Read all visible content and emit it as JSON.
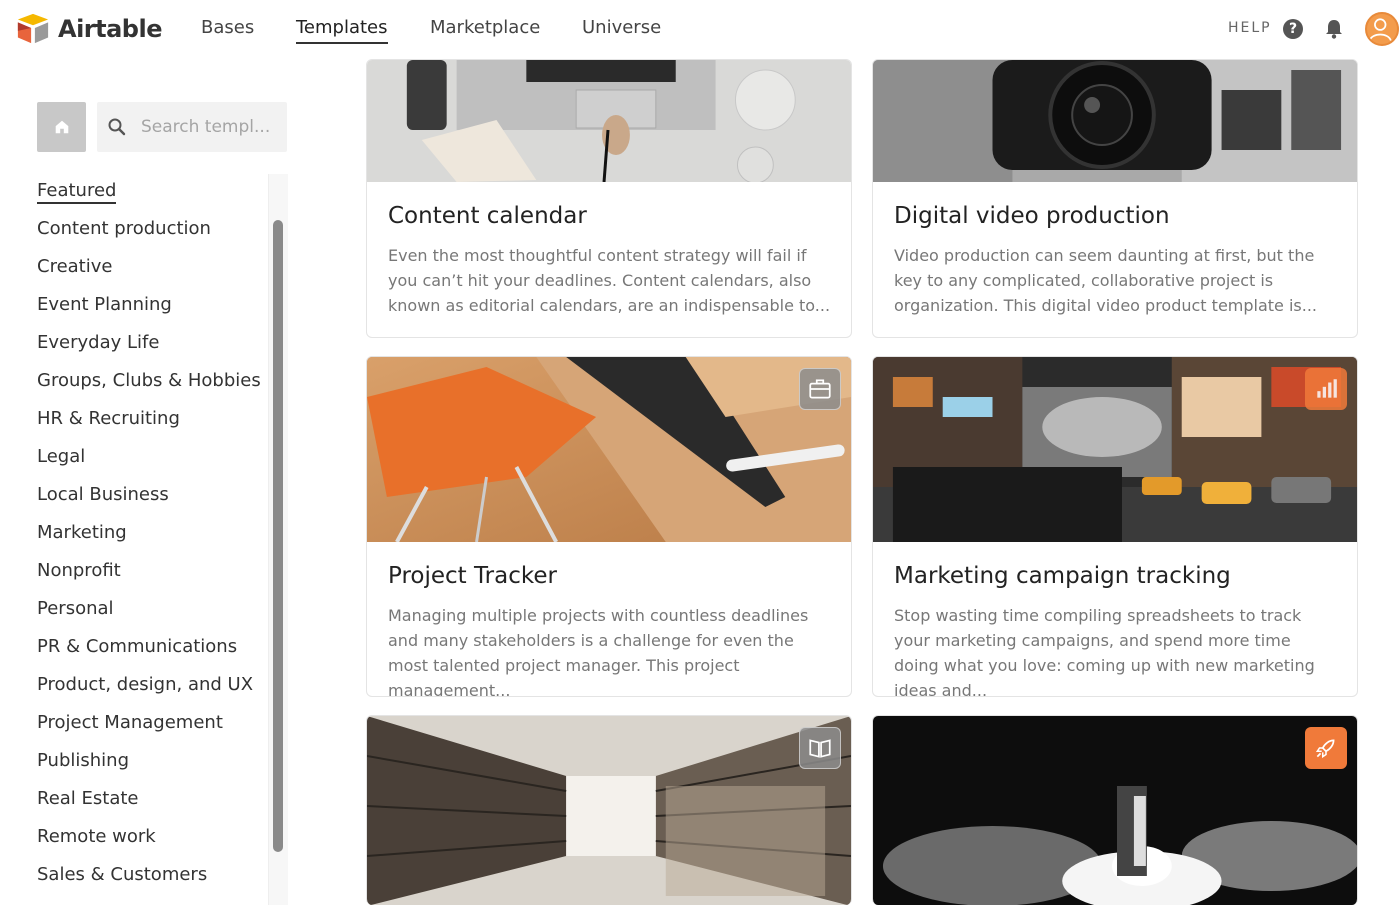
{
  "app": {
    "name": "Airtable"
  },
  "nav": {
    "items": [
      {
        "label": "Bases"
      },
      {
        "label": "Templates"
      },
      {
        "label": "Marketplace"
      },
      {
        "label": "Universe"
      }
    ],
    "active": "Templates",
    "help_label": "HELP",
    "help_icon": "question-mark",
    "help_icon_glyph": "?"
  },
  "sidebar": {
    "search_placeholder": "Search templ...",
    "categories": [
      "Featured",
      "Content production",
      "Creative",
      "Event Planning",
      "Everyday Life",
      "Groups, Clubs & Hobbies",
      "HR & Recruiting",
      "Legal",
      "Local Business",
      "Marketing",
      "Nonprofit",
      "Personal",
      "PR & Communications",
      "Product, design, and UX",
      "Project Management",
      "Publishing",
      "Real Estate",
      "Remote work",
      "Sales & Customers"
    ],
    "active_category": "Featured"
  },
  "cards": [
    {
      "title": "Content calendar",
      "description": "Even the most thoughtful content strategy will fail if you can’t hit your deadlines. Content calendars, also known as editorial calendars, are an indispensable to...",
      "image": "laptop-desk-photo"
    },
    {
      "title": "Digital video production",
      "description": "Video production can seem daunting at first, but the key to any complicated, collaborative project is organization. This digital video product template is...",
      "image": "camera-lens-photo"
    },
    {
      "title": "Project Tracker",
      "description": "Managing multiple projects with countless deadlines and many stakeholders is a challenge for even the most talented project manager. This project management...",
      "image": "desk-chair-photo",
      "badge": "briefcase-icon"
    },
    {
      "title": "Marketing campaign tracking",
      "description": "Stop wasting time compiling spreadsheets to track your marketing campaigns, and spend more time doing what you love: coming up with new marketing ideas and...",
      "image": "city-street-photo",
      "badge": "bar-chart-icon"
    },
    {
      "title": "",
      "description": "",
      "image": "library-shelves-photo",
      "badge": "book-icon"
    },
    {
      "title": "",
      "description": "",
      "image": "rocket-launch-photo",
      "badge": "rocket-icon"
    }
  ],
  "colors": {
    "accent_orange": "#f07a3a",
    "text_dark": "#222222",
    "text_muted": "#777777"
  }
}
